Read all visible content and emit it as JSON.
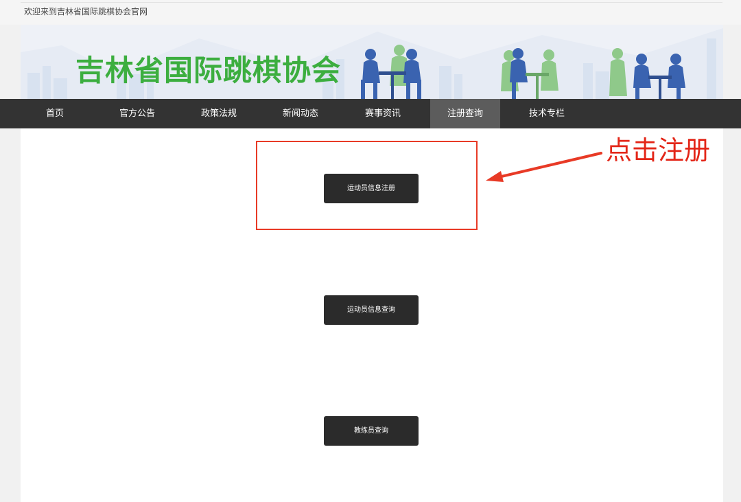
{
  "header": {
    "welcome_text": "欢迎来到吉林省国际跳棋协会官网",
    "site_title": "吉林省国际跳棋协会"
  },
  "nav": {
    "items": [
      {
        "label": "首页"
      },
      {
        "label": "官方公告"
      },
      {
        "label": "政策法规"
      },
      {
        "label": "新闻动态"
      },
      {
        "label": "赛事资讯"
      },
      {
        "label": "注册查询",
        "active": true
      },
      {
        "label": "技术专栏"
      }
    ]
  },
  "actions": {
    "athlete_register": "运动员信息注册",
    "athlete_query": "运动员信息查询",
    "coach_query": "教练员查询"
  },
  "annotation": {
    "callout": "点击注册"
  },
  "colors": {
    "nav_bg": "#333333",
    "nav_active": "#5c5c5c",
    "title_green": "#3cae3f",
    "annotation_red": "#e83a26",
    "button_bg": "#2b2b2b"
  }
}
